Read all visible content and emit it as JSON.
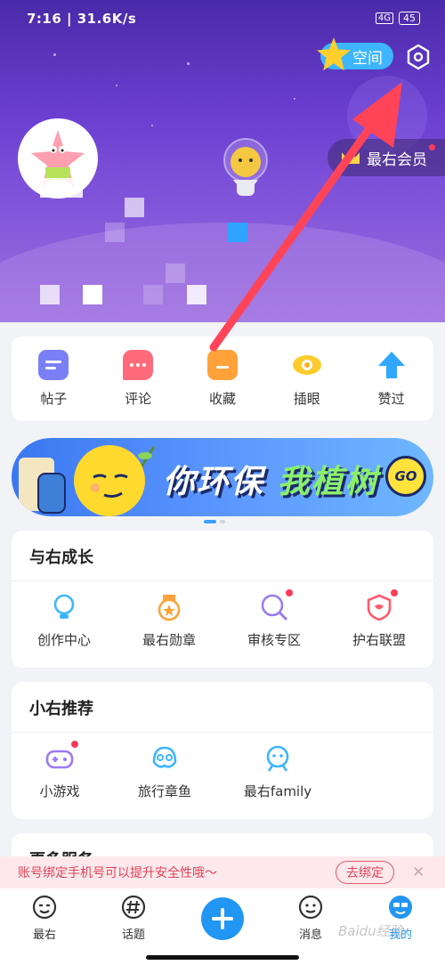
{
  "status_bar": {
    "time_speed": "7:16 | 31.6K/s",
    "signal": "4G",
    "battery": "45"
  },
  "header": {
    "space_label": "空间",
    "vip_label": "最右会员"
  },
  "quick_actions": [
    {
      "label": "帖子",
      "color": "#7b7ff5"
    },
    {
      "label": "评论",
      "color": "#ff6b7a"
    },
    {
      "label": "收藏",
      "color": "#ffa23a"
    },
    {
      "label": "插眼",
      "color": "#ffcc2e"
    },
    {
      "label": "赞过",
      "color": "#2fa7ff"
    }
  ],
  "banner": {
    "text_white": "你环保",
    "text_green": "我植树",
    "go_label": "GO"
  },
  "growth": {
    "title": "与右成长",
    "items": [
      {
        "label": "创作中心",
        "icon": "bulb-icon",
        "color": "#3cb6ff",
        "dot": false
      },
      {
        "label": "最右勋章",
        "icon": "medal-icon",
        "color": "#ffa23a",
        "dot": false
      },
      {
        "label": "审核专区",
        "icon": "review-search-icon",
        "color": "#9a7bf0",
        "dot": true
      },
      {
        "label": "护右联盟",
        "icon": "shield-icon",
        "color": "#ff5a6e",
        "dot": true
      }
    ]
  },
  "recommend": {
    "title": "小右推荐",
    "items": [
      {
        "label": "小游戏",
        "icon": "gamepad-icon",
        "color": "#9a7bf0",
        "dot": true
      },
      {
        "label": "旅行章鱼",
        "icon": "octopus-icon",
        "color": "#3cb6ff",
        "dot": false
      },
      {
        "label": "最右family",
        "icon": "family-icon",
        "color": "#3cb6ff",
        "dot": false
      }
    ]
  },
  "more_services": {
    "title": "更多服务"
  },
  "notice": {
    "text": "账号绑定手机号可以提升安全性哦～",
    "bind_label": "去绑定",
    "close": "✕"
  },
  "tabbar": {
    "items": [
      {
        "label": "最右",
        "icon": "face-icon"
      },
      {
        "label": "话题",
        "icon": "hashtag-icon"
      },
      {
        "label": "消息",
        "icon": "message-face-icon"
      },
      {
        "label": "我的",
        "icon": "profile-face-icon"
      }
    ]
  },
  "watermark": "Baidu经验",
  "colors": {
    "accent": "#2196f3",
    "header_top": "#4a2aa8",
    "header_bottom": "#9b6fdf",
    "arrow": "#ff4458"
  }
}
